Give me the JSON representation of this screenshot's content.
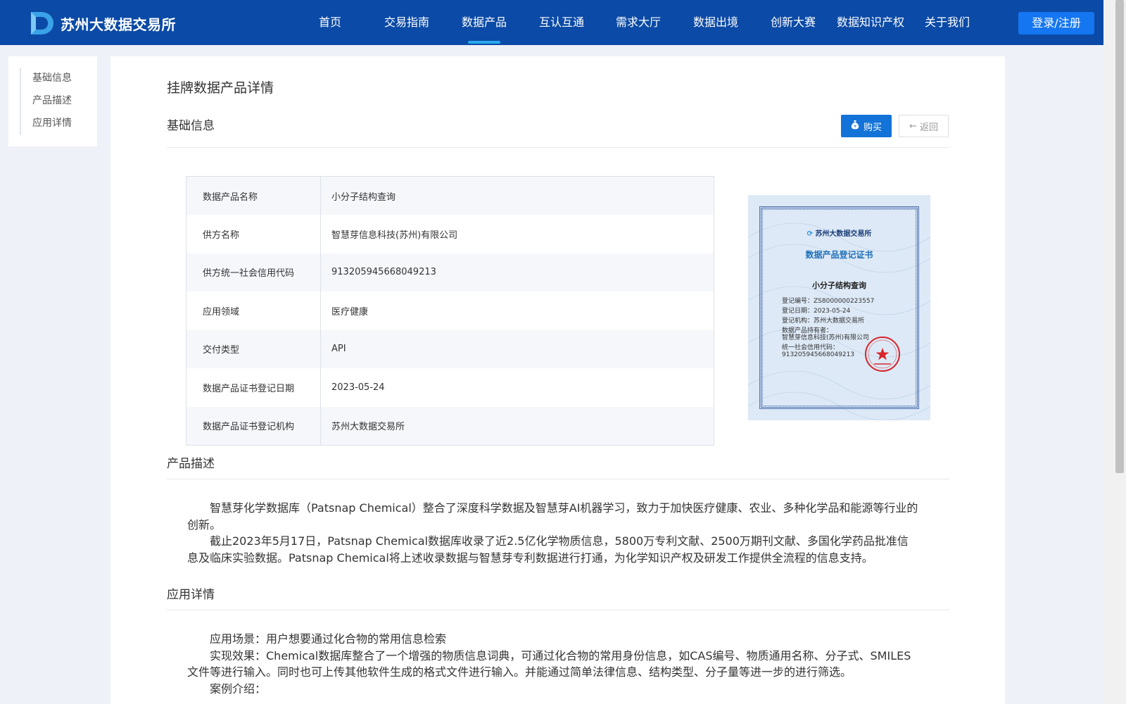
{
  "header": {
    "brand": "苏州大数据交易所",
    "nav": [
      {
        "label": "首页"
      },
      {
        "label": "交易指南"
      },
      {
        "label": "数据产品"
      },
      {
        "label": "互认互通"
      },
      {
        "label": "需求大厅"
      },
      {
        "label": "数据出境"
      },
      {
        "label": "创新大赛"
      },
      {
        "label": "数据知识产权"
      },
      {
        "label": "关于我们"
      }
    ],
    "active_nav": "数据产品",
    "login_label": "登录/注册",
    "bar_color": "#0b4aa6",
    "accent_color": "#29a9f0"
  },
  "side_menu": {
    "items": [
      {
        "label": "基础信息"
      },
      {
        "label": "产品描述"
      },
      {
        "label": "应用详情"
      }
    ]
  },
  "page": {
    "title": "挂牌数据产品详情",
    "basic_section_title": "基础信息",
    "buy_label": "购买",
    "back_label": "返回",
    "desc_section_title": "产品描述",
    "app_section_title": "应用详情"
  },
  "info_table": [
    {
      "key": "数据产品名称",
      "value": "小分子结构查询"
    },
    {
      "key": "供方名称",
      "value": "智慧芽信息科技(苏州)有限公司"
    },
    {
      "key": "供方统一社会信用代码",
      "value": "913205945668049213"
    },
    {
      "key": "应用领域",
      "value": "医疗健康"
    },
    {
      "key": "交付类型",
      "value": "API"
    },
    {
      "key": "数据产品证书登记日期",
      "value": "2023-05-24"
    },
    {
      "key": "数据产品证书登记机构",
      "value": "苏州大数据交易所"
    }
  ],
  "certificate": {
    "issuer": "苏州大数据交易所",
    "title": "数据产品登记证书",
    "product": "小分子结构查询",
    "reg_no": "登记编号：ZS8000000223557",
    "reg_date": "登记日期：2023-05-24",
    "reg_org": "登记机构：苏州大数据交易所",
    "holder_label": "数据产品持有者：",
    "holder": "智慧芽信息科技(苏州)有限公司",
    "credit_label": "统一社会信用代码：",
    "credit_code": "913205945668049213",
    "seal_text": "苏州大数据交易所有限公司",
    "seal_sub": "业务专用章"
  },
  "description": [
    "智慧芽化学数据库（Patsnap Chemical）整合了深度科学数据及智慧芽AI机器学习，致力于加快医疗健康、农业、多种化学品和能源等行业的创新。",
    "截止2023年5月17日，Patsnap Chemical数据库收录了近2.5亿化学物质信息，5800万专利文献、2500万期刊文献、多国化学药品批准信息及临床实验数据。Patsnap Chemical将上述收录数据与智慧芽专利数据进行打通，为化学知识产权及研发工作提供全流程的信息支持。"
  ],
  "application": [
    "应用场景：用户想要通过化合物的常用信息检索",
    "实现效果：Chemical数据库整合了一个增强的物质信息词典，可通过化合物的常用身份信息，如CAS编号、物质通用名称、分子式、SMILES文件等进行输入。同时也可上传其他软件生成的格式文件进行输入。并能通过简单法律信息、结构类型、分子量等进一步的进行筛选。",
    "案例介绍："
  ]
}
